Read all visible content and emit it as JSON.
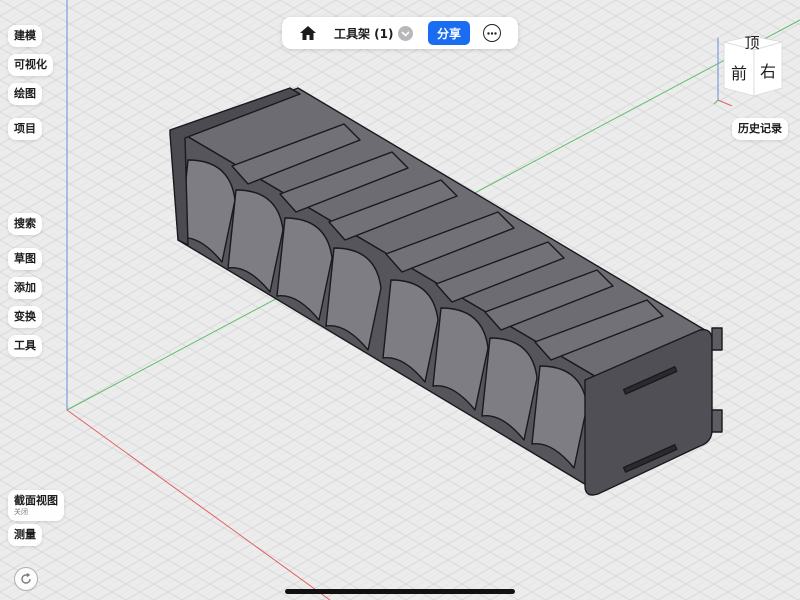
{
  "left_toolbar": {
    "build": "建模",
    "visualize": "可视化",
    "drawing": "绘图",
    "project": "项目",
    "search": "搜索",
    "sketch": "草图",
    "add": "添加",
    "transform": "变换",
    "tools": "工具",
    "section_view": "截面视图",
    "section_view_state": "关闭",
    "measure": "测量"
  },
  "topbar": {
    "title": "工具架 (1)",
    "share": "分享"
  },
  "right_panel": {
    "history": "历史记录"
  },
  "view_cube": {
    "top": "顶",
    "front": "前",
    "right": "右"
  },
  "colors": {
    "accent": "#1a6cf0",
    "model": "#5d5d63",
    "axis_x": "#e06060",
    "axis_y": "#5fbf6a",
    "axis_z": "#6a8fd8"
  }
}
